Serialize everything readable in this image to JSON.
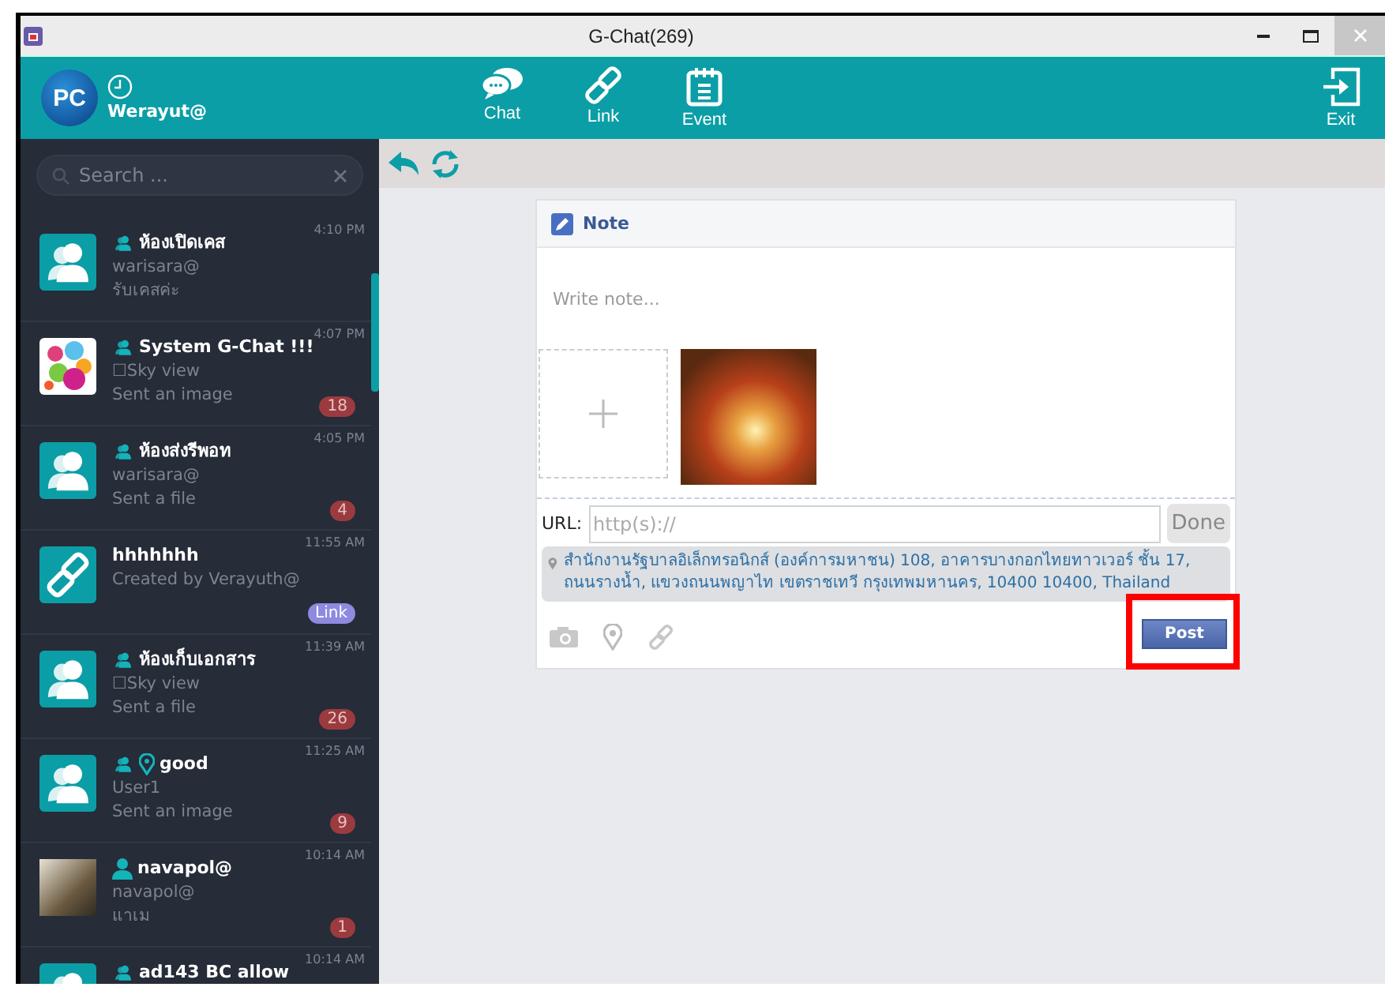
{
  "window": {
    "title": "G-Chat(269)"
  },
  "header": {
    "user": {
      "initials": "PC",
      "name": "Werayut@"
    },
    "nav": [
      {
        "kind": "chat",
        "label": "Chat"
      },
      {
        "kind": "link",
        "label": "Link"
      },
      {
        "kind": "event",
        "label": "Event"
      }
    ],
    "exit": {
      "label": "Exit"
    }
  },
  "sidebar": {
    "search": {
      "placeholder": "Search ..."
    },
    "chats": [
      {
        "kind": "group",
        "marks": [
          {
            "kind": "group"
          }
        ],
        "name": "ห้องเปิดเคส",
        "line1": "warisara@",
        "line2": "รับเคสค่ะ",
        "time": "4:10 PM"
      },
      {
        "kind": "picture",
        "marks": [
          {
            "kind": "group"
          }
        ],
        "name": "System G-Chat !!!",
        "line1": "☐Sky view",
        "line2": "Sent an image",
        "time": "4:07 PM",
        "badge": {
          "kind": "count",
          "text": "18"
        }
      },
      {
        "kind": "group",
        "marks": [
          {
            "kind": "group"
          }
        ],
        "name": "ห้องส่งรีพอท",
        "line1": "warisara@",
        "line2": "Sent a file",
        "time": "4:05 PM",
        "badge": {
          "kind": "count",
          "text": "4"
        }
      },
      {
        "kind": "link",
        "name": "hhhhhhh",
        "line1": "Created by Verayuth@",
        "time": "11:55 AM",
        "badge": {
          "kind": "tag",
          "text": "Link"
        }
      },
      {
        "kind": "group",
        "marks": [
          {
            "kind": "group"
          }
        ],
        "name": "ห้องเก็บเอกสาร",
        "line1": "☐Sky view",
        "line2": "Sent a file",
        "time": "11:39 AM",
        "badge": {
          "kind": "count",
          "text": "26"
        }
      },
      {
        "kind": "group",
        "marks": [
          {
            "kind": "group"
          },
          {
            "kind": "pin"
          }
        ],
        "name": "good",
        "line1": "User1",
        "line2": "Sent an image",
        "time": "11:25 AM",
        "badge": {
          "kind": "count",
          "text": "9"
        }
      },
      {
        "kind": "photo",
        "marks": [
          {
            "kind": "person"
          }
        ],
        "name": "navapol@",
        "line1": "navapol@",
        "line2": "แาเม",
        "time": "10:14 AM",
        "badge": {
          "kind": "count",
          "text": "1"
        }
      },
      {
        "kind": "group",
        "marks": [
          {
            "kind": "group"
          }
        ],
        "name": "ad143 BC allow",
        "time": "10:14 AM"
      }
    ]
  },
  "note": {
    "title": "Note",
    "placeholder": "Write note...",
    "url_label": "URL:",
    "url_placeholder": "http(s)://",
    "done": "Done",
    "location": "สำนักงานรัฐบาลอิเล็กทรอนิกส์ (องค์การมหาชน) 108, อาคารบางกอกไทยทาวเวอร์ ชั้น 17, ถนนรางน้ำ, แขวงถนนพญาไท เขตราชเทวี กรุงเทพมหานคร, 10400 10400, Thailand",
    "post": {
      "label": "Post",
      "highlighted": true
    }
  }
}
